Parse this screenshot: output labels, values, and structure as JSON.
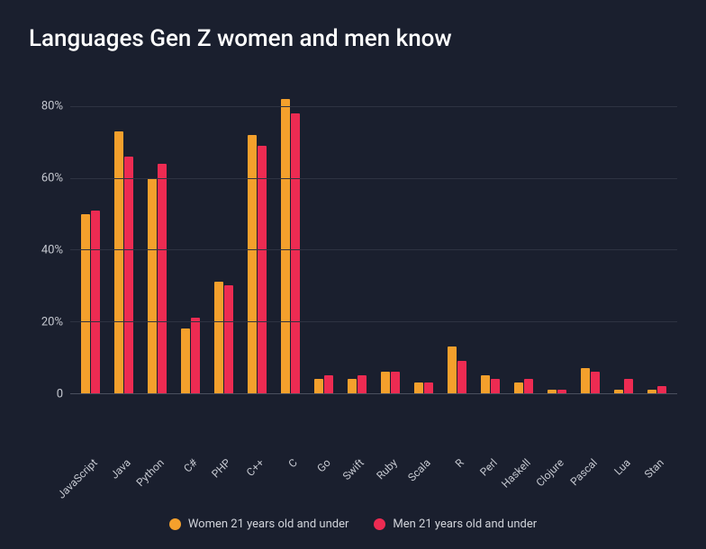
{
  "chart_data": {
    "type": "bar",
    "title": "Languages Gen Z women and men know",
    "xlabel": "",
    "ylabel": "",
    "ylim": [
      0,
      85
    ],
    "yticks": [
      0,
      20,
      40,
      60,
      80
    ],
    "ytick_labels": [
      "0",
      "20%",
      "40%",
      "60%",
      "80%"
    ],
    "categories": [
      "JavaScript",
      "Java",
      "Python",
      "C#",
      "PHP",
      "C++",
      "C",
      "Go",
      "Swift",
      "Ruby",
      "Scala",
      "R",
      "Perl",
      "Haskell",
      "Clojure",
      "Pascal",
      "Lua",
      "Stan"
    ],
    "series": [
      {
        "name": "Women 21 years old and under",
        "color": "#f4a02c",
        "values": [
          50,
          73,
          60,
          18,
          31,
          72,
          82,
          4,
          4,
          6,
          3,
          13,
          5,
          3,
          1,
          7,
          1,
          1
        ]
      },
      {
        "name": "Men 21 years old and under",
        "color": "#ed2b52",
        "values": [
          51,
          66,
          64,
          21,
          30,
          69,
          78,
          5,
          5,
          6,
          3,
          9,
          4,
          4,
          1,
          6,
          4,
          2
        ]
      }
    ]
  }
}
